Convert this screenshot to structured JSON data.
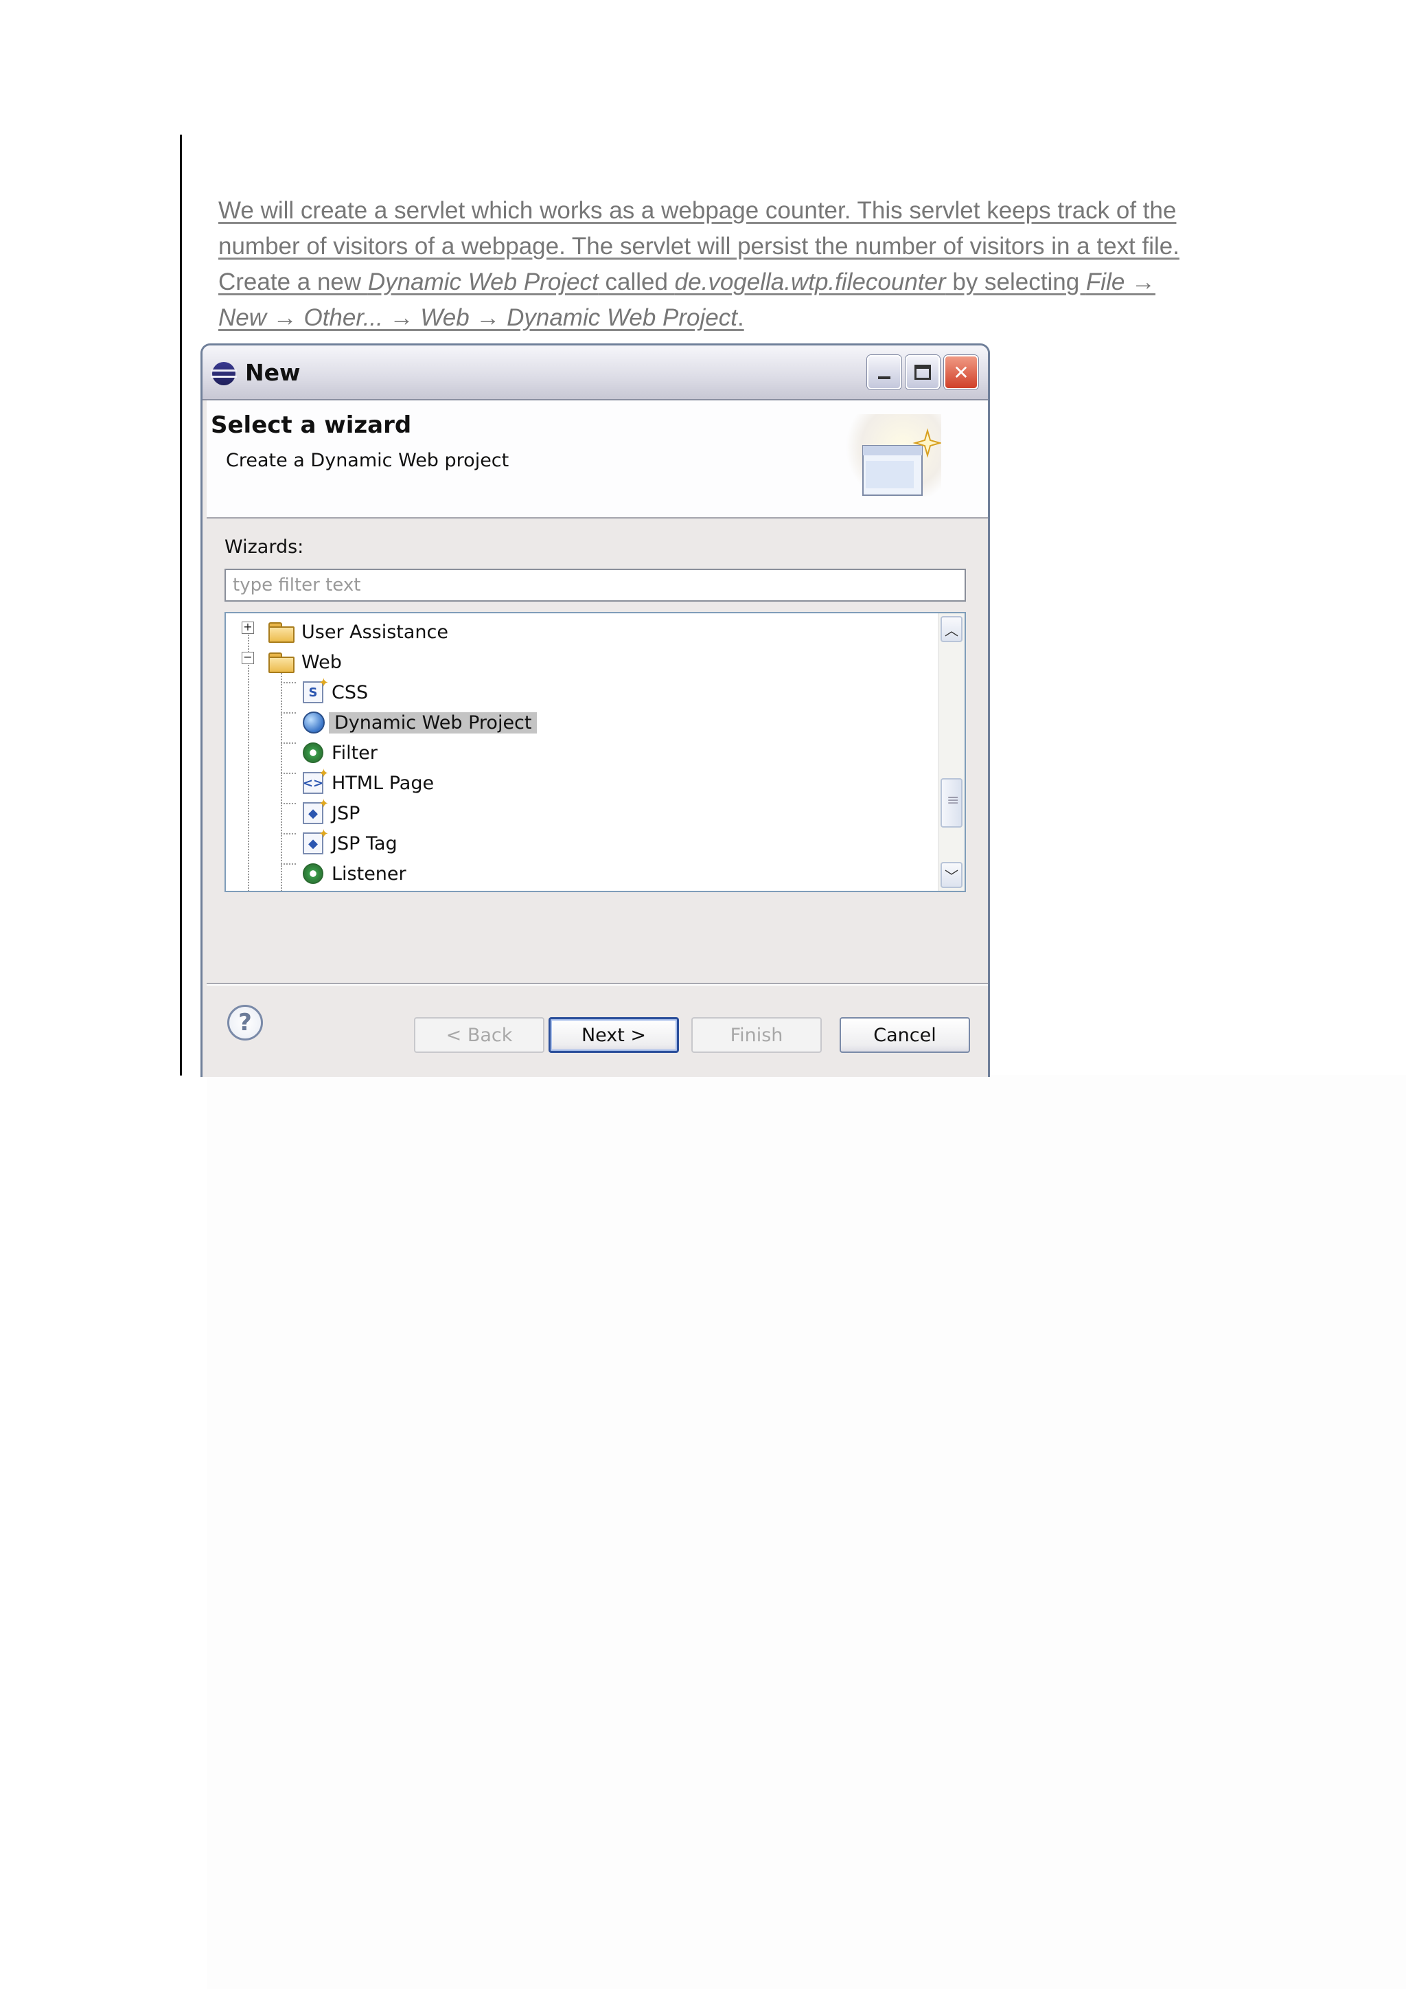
{
  "intro": {
    "p1": "We will create a servlet which works as a webpage counter. This servlet keeps track of the number of visitors of a webpage. The servlet will persist the number of visitors in a text file. Create a new ",
    "project_type": "Dynamic Web Project",
    "p2": " called ",
    "project_name": "de.vogella.wtp.filecounter",
    "p3": " by selecting ",
    "menu_path": "File → New → Other... → Web → Dynamic Web Project",
    "p4": "."
  },
  "dialog": {
    "title": "New",
    "header_title": "Select a wizard",
    "header_description": "Create a Dynamic Web project",
    "wizards_label": "Wizards:",
    "filter_placeholder": "type filter text",
    "tree": {
      "folder_user_assistance": "User Assistance",
      "folder_web": "Web",
      "items": [
        "CSS",
        "Dynamic Web Project",
        "Filter",
        "HTML Page",
        "JSP",
        "JSP Tag",
        "Listener"
      ],
      "selected": "Dynamic Web Project"
    },
    "buttons": {
      "back": "< Back",
      "next": "Next >",
      "finish": "Finish",
      "cancel": "Cancel"
    }
  }
}
